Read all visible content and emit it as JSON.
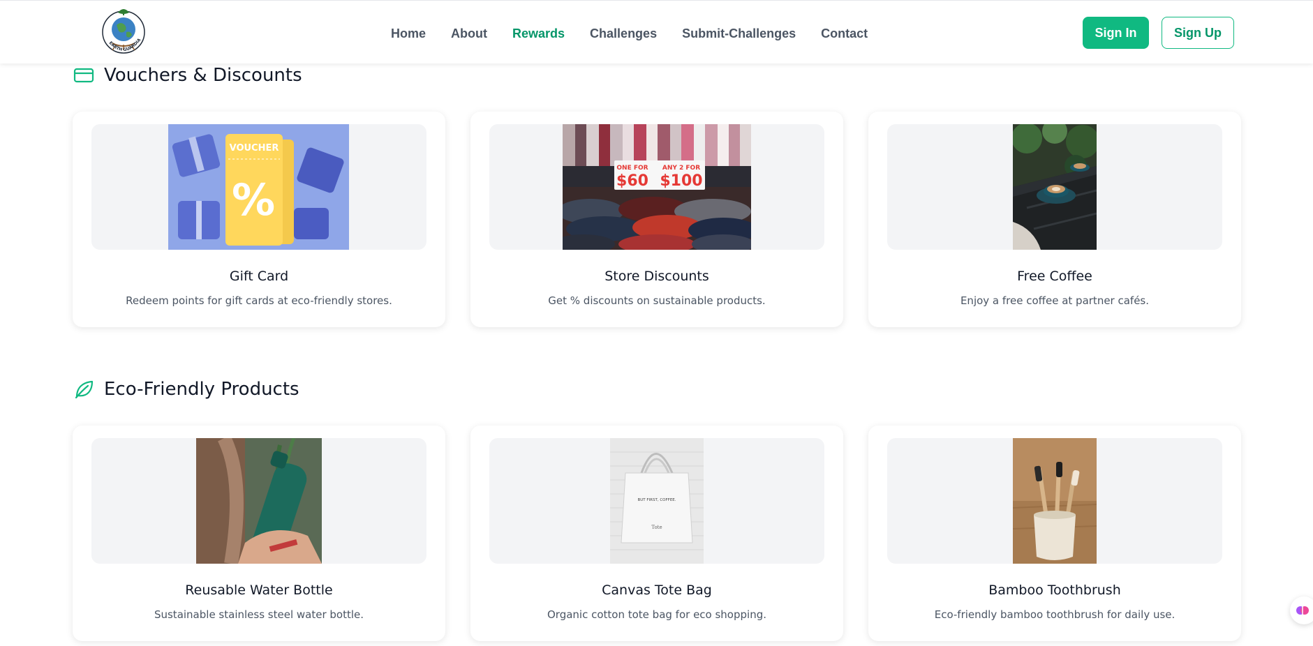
{
  "header": {
    "logo_text": "EARTH GUARDIANS",
    "nav": [
      {
        "label": "Home",
        "active": false
      },
      {
        "label": "About",
        "active": false
      },
      {
        "label": "Rewards",
        "active": true
      },
      {
        "label": "Challenges",
        "active": false
      },
      {
        "label": "Submit-Challenges",
        "active": false
      },
      {
        "label": "Contact",
        "active": false
      }
    ],
    "sign_in_label": "Sign In",
    "sign_up_label": "Sign Up",
    "accent_color": "#10b981"
  },
  "sections": [
    {
      "title": "Vouchers & Discounts",
      "icon": "credit-card-icon",
      "items": [
        {
          "name": "Gift Card",
          "description": "Redeem points for gift cards at eco-friendly stores.",
          "image_text": [
            "VOUCHER",
            "%"
          ]
        },
        {
          "name": "Store Discounts",
          "description": "Get % discounts on sustainable products.",
          "image_text": [
            "ONE FOR",
            "$60",
            "ANY 2 FOR",
            "$100"
          ]
        },
        {
          "name": "Free Coffee",
          "description": "Enjoy a free coffee at partner cafés."
        }
      ]
    },
    {
      "title": "Eco-Friendly Products",
      "icon": "leaf-icon",
      "items": [
        {
          "name": "Reusable Water Bottle",
          "description": "Sustainable stainless steel water bottle."
        },
        {
          "name": "Canvas Tote Bag",
          "description": "Organic cotton tote bag for eco shopping.",
          "image_text": [
            "BUT FIRST, COFFEE.",
            "Tote"
          ]
        },
        {
          "name": "Bamboo Toothbrush",
          "description": "Eco-friendly bamboo toothbrush for daily use."
        }
      ]
    }
  ]
}
